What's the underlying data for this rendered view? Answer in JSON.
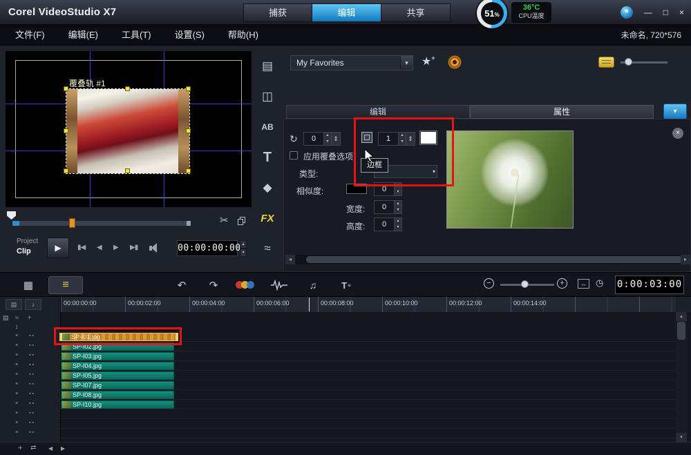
{
  "titlebar": {
    "app_title": "Corel VideoStudio X7",
    "steps": [
      "捕获",
      "编辑",
      "共享"
    ],
    "active_step": "编辑",
    "cpu_percent": "51",
    "cpu_percent_unit": "%",
    "cpu_temp": "36°C",
    "cpu_temp_label": "CPU温度"
  },
  "menubar": {
    "items": [
      "文件(F)",
      "编辑(E)",
      "工具(T)",
      "设置(S)",
      "帮助(H)"
    ],
    "project_info": "未命名, 720*576"
  },
  "preview": {
    "overlay_track_label": "覆叠轨 #1",
    "project_label": "Project",
    "clip_label": "Clip",
    "timecode": "00:00:00:00"
  },
  "library": {
    "gallery": "My Favorites"
  },
  "options": {
    "tabs": [
      "编辑",
      "属性"
    ],
    "active_tab": "属性",
    "transparency_value": "0",
    "border_width_value": "1",
    "apply_overlay_label": "应用覆叠选项",
    "type_label": "类型:",
    "similarity_label": "相似度:",
    "similarity_value": "0",
    "width_label": "宽度:",
    "width_value": "0",
    "height_label": "高度:",
    "height_value": "0",
    "tooltip_text": "边框"
  },
  "timeline": {
    "zoom_timecode": "0:00:03:00",
    "ruler_labels": [
      "00:00:00:00",
      "00:00:02:00",
      "00:00:04:00",
      "00:00:06:00",
      "00:00:08:00",
      "00:00:10:00",
      "00:00:12:00",
      "00:00:14:00"
    ],
    "clips": [
      "SP-I01.jpg",
      "SP-I02.jpg",
      "SP-I03.jpg",
      "SP-I04.jpg",
      "SP-I05.jpg",
      "SP-I07.jpg",
      "SP-I08.jpg",
      "SP-I10.jpg"
    ],
    "selected_clip": "SP-I01.jpg"
  },
  "icons": {
    "connect": "*",
    "minimize": "—",
    "maximize": "□",
    "close": "×",
    "dropdown": "▾",
    "star": "★",
    "plus": "+",
    "nav_media": "▤",
    "nav_transition": "◫",
    "nav_title_ab": "AB",
    "nav_title": "T",
    "nav_graphic": "◆",
    "nav_fx": "FX",
    "nav_path": "≈",
    "play": "▶",
    "home": "▮◀",
    "prev": "◀",
    "next": "▶",
    "end": "▶▮",
    "scissors": "✂",
    "spin_up": "▴",
    "spin_down": "▾",
    "spin_slider": "⇕",
    "transparency": "↻",
    "close_small": "×",
    "storyboard": "▦",
    "timeline_view": "≡",
    "undo": "↶",
    "redo": "↷",
    "music": "♫",
    "subtitle": "T",
    "zoom_out": "−",
    "zoom_in": "+",
    "fit": "↔",
    "clock": "◷",
    "scroll_left": "◂",
    "scroll_right": "▸",
    "scroll_up": "▴",
    "scroll_down": "▾",
    "track_film": "▤",
    "track_audio": "♪",
    "swap": "⇄",
    "row_drag": "≡",
    "row_type": "▪▪"
  },
  "colors": {
    "accent_blue": "#2da9e8",
    "clip_color": "#0e7a68",
    "selected_clip_color": "#d8932c",
    "annotation_color": "#e81313",
    "fx_icon_color": "#f0d23c",
    "cpu_temp_color": "#35d04a"
  }
}
